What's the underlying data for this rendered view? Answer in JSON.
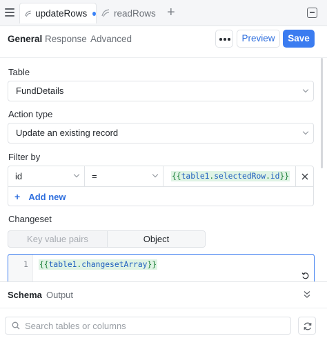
{
  "tabs": [
    {
      "label": "updateRows",
      "active": true,
      "unsaved": true
    },
    {
      "label": "readRows",
      "active": false
    }
  ],
  "nav": {
    "tabs": [
      "General",
      "Response",
      "Advanced"
    ],
    "preview_label": "Preview",
    "save_label": "Save"
  },
  "form": {
    "table_label": "Table",
    "table_value": "FundDetails",
    "action_label": "Action type",
    "action_value": "Update an existing record",
    "filter_label": "Filter by",
    "filter": {
      "column": "id",
      "operator": "=",
      "value_open": "{{",
      "value_ref": "table1",
      "value_dot": ".",
      "value_prop": "selectedRow",
      "value_dot2": ".",
      "value_field": "id",
      "value_close": "}}"
    },
    "add_new_label": "Add new",
    "changeset_label": "Changeset",
    "changeset_modes": [
      "Key value pairs",
      "Object"
    ],
    "changeset_selected": "Object",
    "editor": {
      "line_number": "1",
      "code_open": "{{",
      "code_ref": "table1",
      "code_dot": ".",
      "code_prop": "changesetArray",
      "code_close": "}}"
    }
  },
  "bottom": {
    "tabs": [
      "Schema",
      "Output"
    ],
    "search_placeholder": "Search tables or columns"
  },
  "colors": {
    "accent": "#3b7cf0",
    "code_bg": "#dff3e4",
    "code_text": "#1a7f37"
  }
}
